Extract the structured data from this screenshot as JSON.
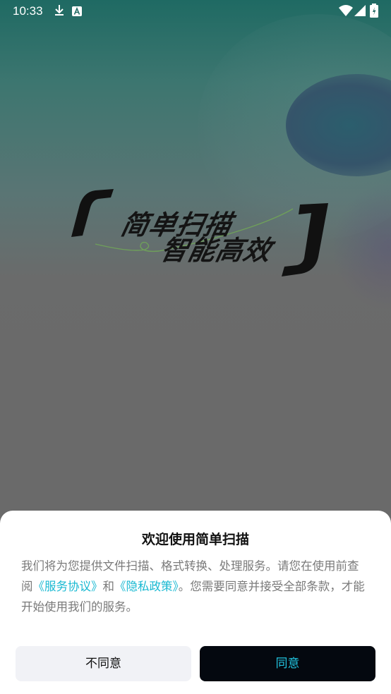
{
  "status_bar": {
    "time": "10:33",
    "icons": [
      "download-icon",
      "a-notification-icon",
      "wifi-icon",
      "signal-icon",
      "battery-icon"
    ]
  },
  "splash": {
    "slogan_line1": "简单扫描",
    "slogan_line2": "智能高效"
  },
  "dialog": {
    "title": "欢迎使用简单扫描",
    "body_part1": "我们将为您提供文件扫描、格式转换、处理服务。请您在使用前查阅",
    "link_service": "《服务协议》",
    "body_and": "和",
    "link_privacy": "《隐私政策》",
    "body_part2": "。您需要同意并接受全部条款，才能开始使用我们的服务。",
    "disagree_label": "不同意",
    "agree_label": "同意"
  },
  "colors": {
    "link": "#19b9d2",
    "agree_bg": "#04080f",
    "agree_text": "#21c3df",
    "disagree_bg": "#f1f2f6"
  }
}
